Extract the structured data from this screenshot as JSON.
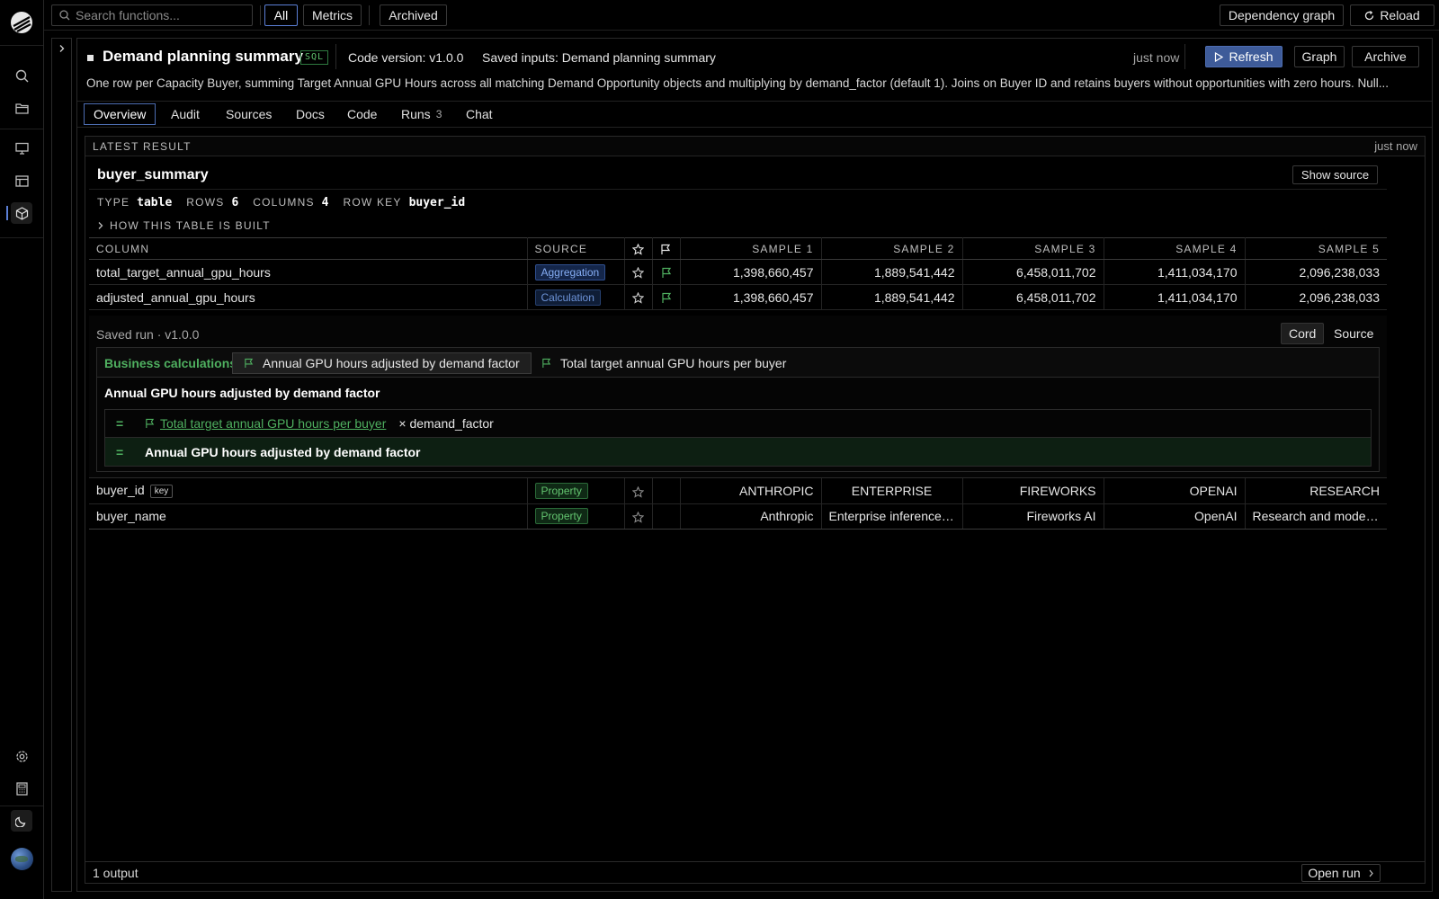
{
  "topbar": {
    "search_placeholder": "Search functions...",
    "filters": [
      "All",
      "Metrics",
      "Archived"
    ],
    "dependency_graph": "Dependency graph",
    "reload": "Reload"
  },
  "header": {
    "title": "Demand planning summary",
    "badge": "SQL",
    "code_version": "Code version: v1.0.0",
    "saved_inputs": "Saved inputs: Demand planning summary",
    "updated": "just now",
    "refresh": "Refresh",
    "graph": "Graph",
    "archive": "Archive",
    "description": "One row per Capacity Buyer, summing Target Annual GPU Hours across all matching Demand Opportunity objects and multiplying by demand_factor (default 1). Joins on Buyer ID and retains buyers without opportunities with zero hours. Null..."
  },
  "tabs": {
    "overview": "Overview",
    "audit": "Audit",
    "sources": "Sources",
    "docs": "Docs",
    "code": "Code",
    "runs": "Runs",
    "runs_count": "3",
    "chat": "Chat"
  },
  "result": {
    "label": "LATEST RESULT",
    "updated": "just now",
    "table_name": "buyer_summary",
    "show_source": "Show source",
    "meta": {
      "type_k": "TYPE",
      "type_v": "table",
      "rows_k": "ROWS",
      "rows_v": "6",
      "cols_k": "COLUMNS",
      "cols_v": "4",
      "key_k": "ROW KEY",
      "key_v": "buyer_id"
    },
    "how_built": "HOW THIS TABLE IS BUILT",
    "headers": {
      "column": "COLUMN",
      "source": "SOURCE",
      "s1": "SAMPLE 1",
      "s2": "SAMPLE 2",
      "s3": "SAMPLE 3",
      "s4": "SAMPLE 4",
      "s5": "SAMPLE 5"
    },
    "rows": [
      {
        "name": "total_target_annual_gpu_hours",
        "source": "Aggregation",
        "samples": [
          "1,398,660,457",
          "1,889,541,442",
          "6,458,011,702",
          "1,411,034,170",
          "2,096,238,033"
        ]
      },
      {
        "name": "adjusted_annual_gpu_hours",
        "source": "Calculation",
        "samples": [
          "1,398,660,457",
          "1,889,541,442",
          "6,458,011,702",
          "1,411,034,170",
          "2,096,238,033"
        ]
      }
    ],
    "rows2": [
      {
        "name": "buyer_id",
        "key_tag": "key",
        "source": "Property",
        "samples": [
          "ANTHROPIC",
          "ENTERPRISE",
          "FIREWORKS",
          "OPENAI",
          "RESEARCH"
        ]
      },
      {
        "name": "buyer_name",
        "source": "Property",
        "samples": [
          "Anthropic",
          "Enterprise inference ...",
          "Fireworks AI",
          "OpenAI",
          "Research and model ..."
        ]
      }
    ],
    "footer": "1 output",
    "open_run": "Open run"
  },
  "calc": {
    "saved_run": "Saved run · v1.0.0",
    "view_cord": "Cord",
    "view_source": "Source",
    "section_label": "Business calculations",
    "tab1": "Annual GPU hours adjusted by demand factor",
    "tab2": "Total target annual GPU hours per buyer",
    "title": "Annual GPU hours adjusted by demand factor",
    "eq": "=",
    "link": "Total target annual GPU hours per buyer",
    "op": "× demand_factor",
    "result": "Annual GPU hours adjusted by demand factor"
  },
  "colors": {
    "accent_blue": "#3e5b99",
    "green": "#4fb060",
    "background": "#000000"
  },
  "icons": [
    "logo-icon",
    "search-icon",
    "folder-icon",
    "monitor-icon",
    "table-icon",
    "cube-icon",
    "gear-icon",
    "calculator-icon",
    "moon-icon",
    "star-icon",
    "flag-icon",
    "play-icon",
    "reload-icon",
    "chevron-right-icon"
  ]
}
